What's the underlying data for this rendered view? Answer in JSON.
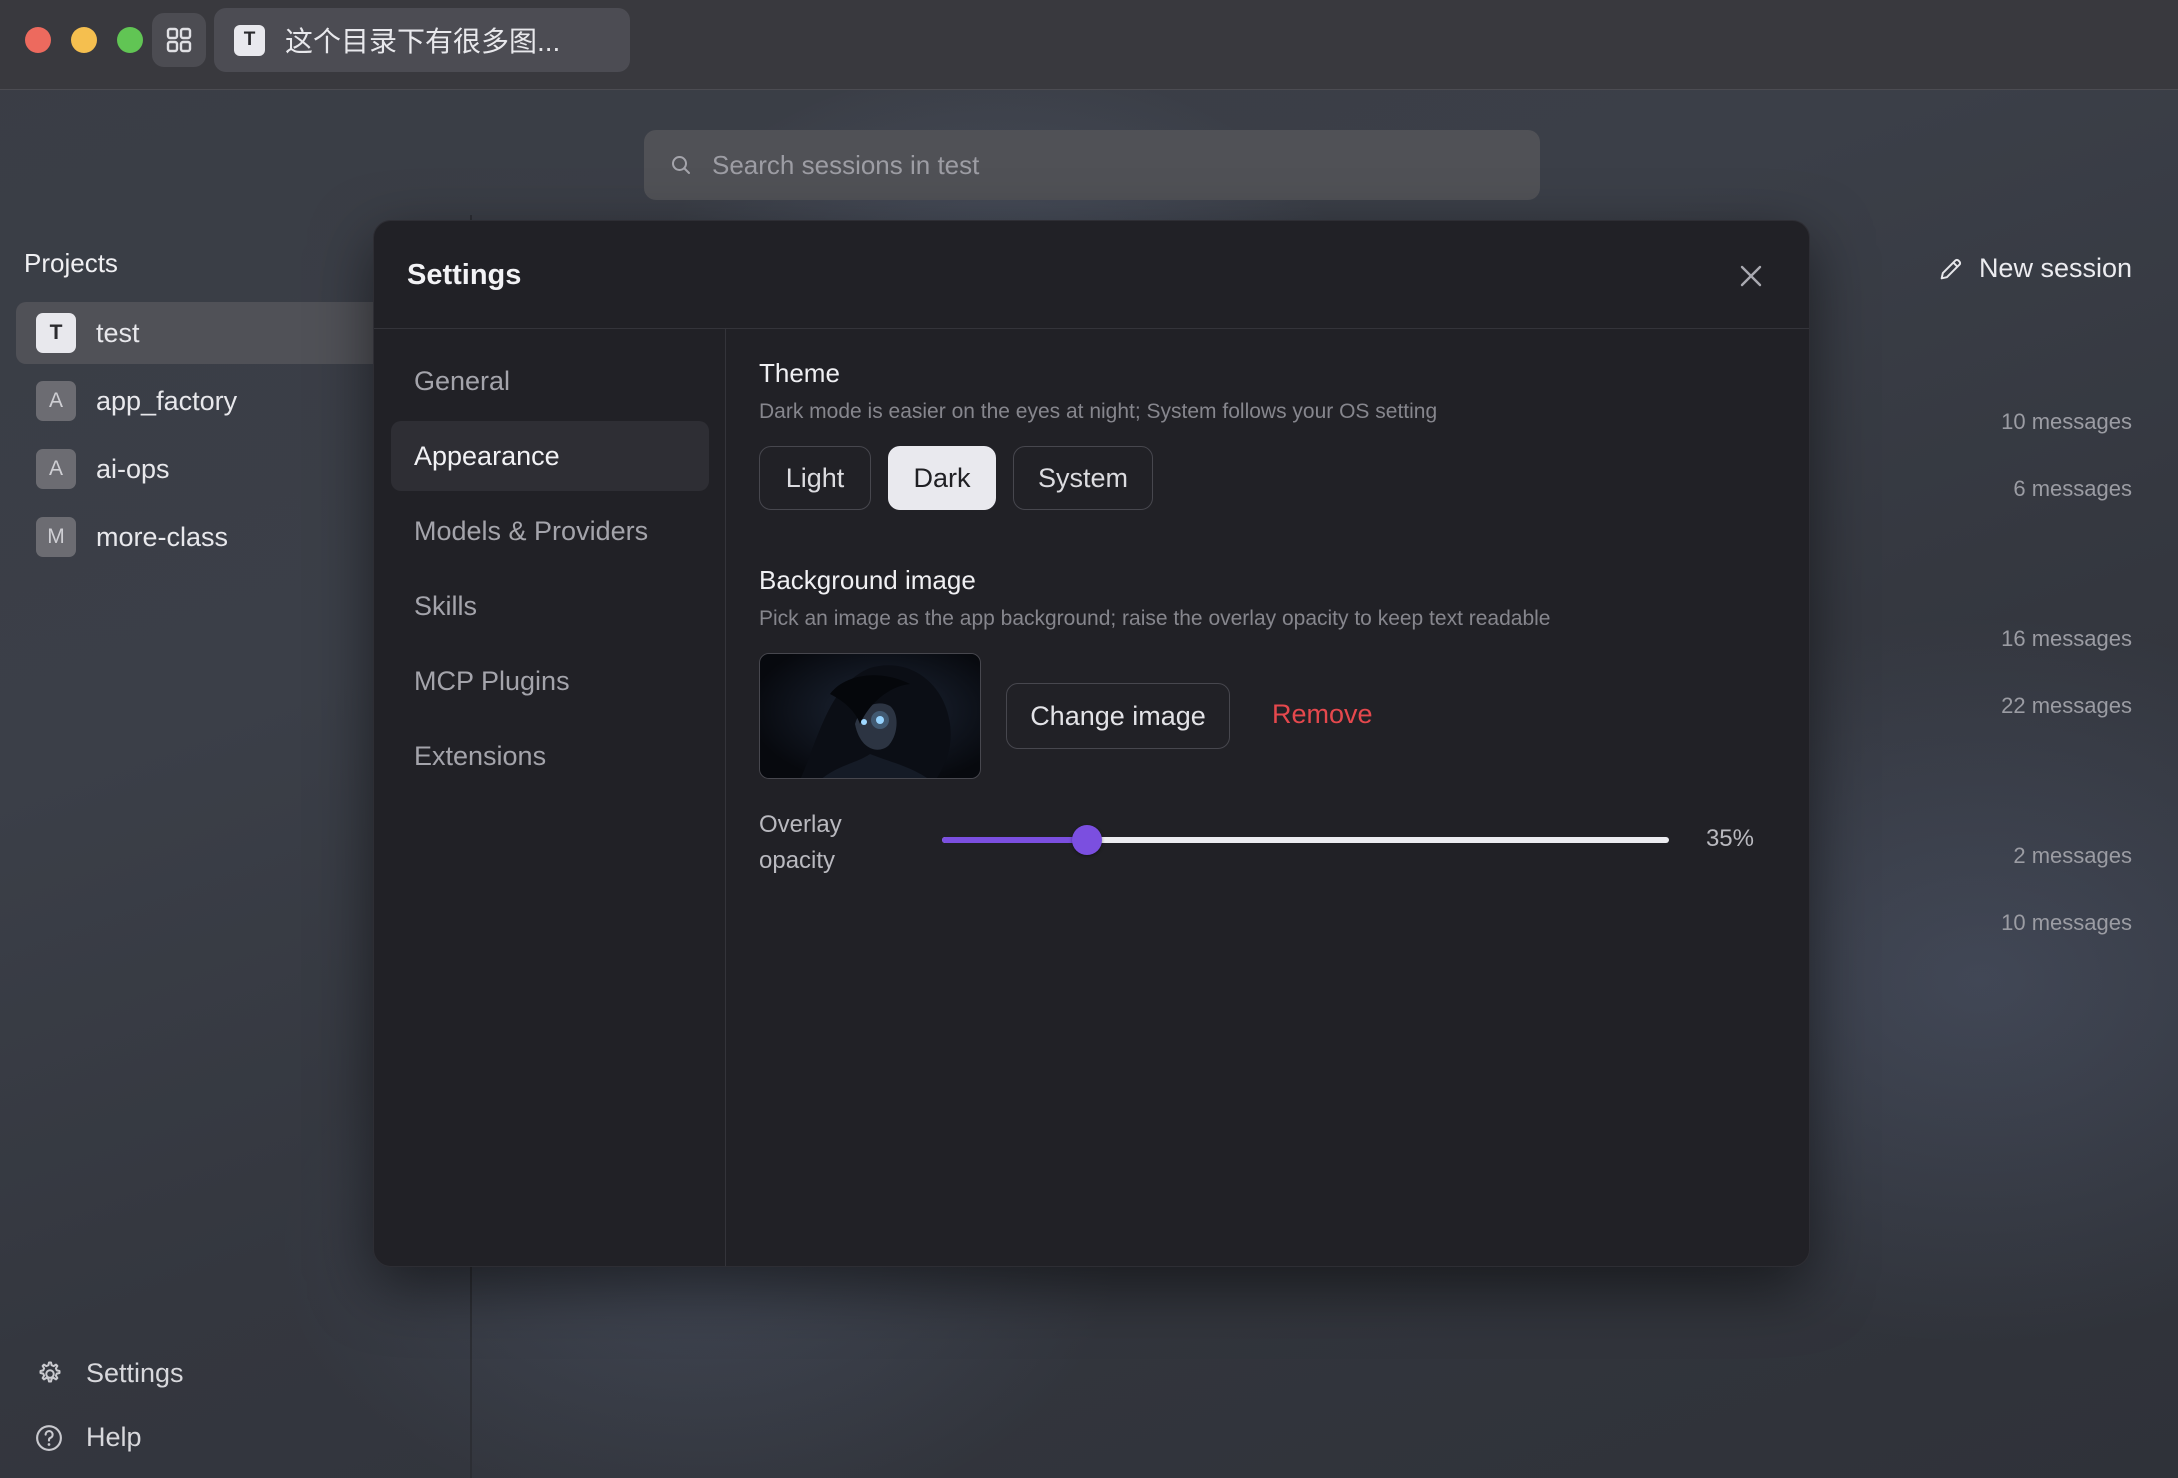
{
  "window": {
    "traffic_lights": {
      "close": "#ed6a5e",
      "minimize": "#f5bf4f",
      "zoom": "#61c554"
    },
    "tab": {
      "avatar": "T",
      "title": "这个目录下有很多图..."
    }
  },
  "search": {
    "placeholder": "Search sessions in test"
  },
  "sidebar": {
    "title": "Projects",
    "projects": [
      {
        "avatar": "T",
        "label": "test",
        "active": true
      },
      {
        "avatar": "A",
        "label": "app_factory",
        "active": false
      },
      {
        "avatar": "A",
        "label": "ai-ops",
        "active": false
      },
      {
        "avatar": "M",
        "label": "more-class",
        "active": false
      }
    ],
    "settings_label": "Settings",
    "help_label": "Help"
  },
  "main": {
    "new_session_label": "New session",
    "message_counts": [
      "10 messages",
      "6 messages",
      "16 messages",
      "22 messages",
      "2 messages",
      "10 messages"
    ]
  },
  "settings_modal": {
    "title": "Settings",
    "nav": [
      {
        "label": "General",
        "active": false
      },
      {
        "label": "Appearance",
        "active": true
      },
      {
        "label": "Models & Providers",
        "active": false
      },
      {
        "label": "Skills",
        "active": false
      },
      {
        "label": "MCP Plugins",
        "active": false
      },
      {
        "label": "Extensions",
        "active": false
      }
    ],
    "theme": {
      "title": "Theme",
      "description": "Dark mode is easier on the eyes at night; System follows your OS setting",
      "options": [
        "Light",
        "Dark",
        "System"
      ],
      "selected": "Dark"
    },
    "background": {
      "title": "Background image",
      "description": "Pick an image as the app background; raise the overlay opacity to keep text readable",
      "change_label": "Change image",
      "remove_label": "Remove",
      "overlay_label": "Overlay opacity",
      "overlay_value": 0.2,
      "overlay_value_text": "35%",
      "accent_color": "#7b4fe0",
      "remove_color": "#e5484d"
    }
  }
}
